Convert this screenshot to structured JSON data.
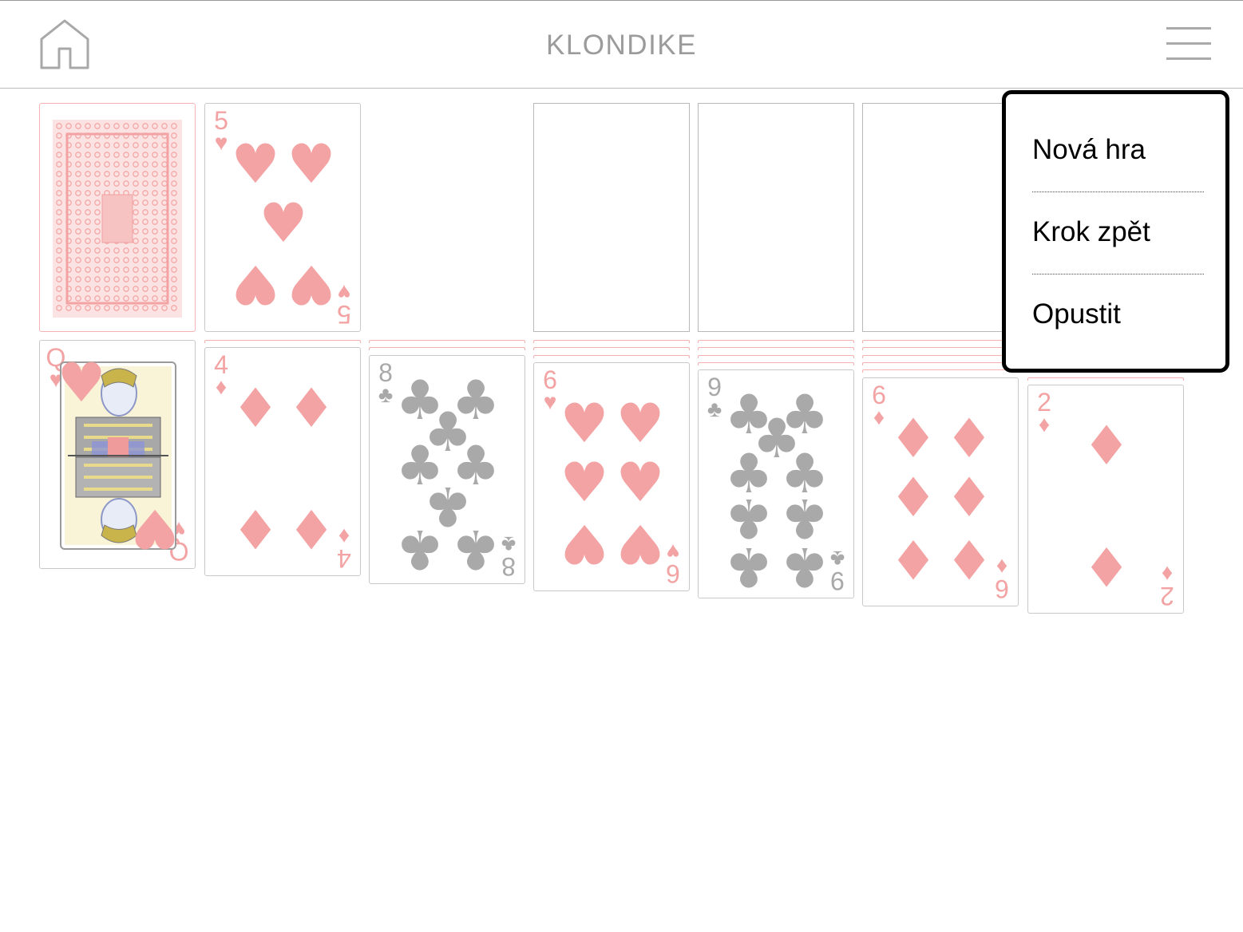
{
  "header": {
    "title": "KLONDIKE",
    "home_icon": "home-icon",
    "menu_icon": "hamburger-menu-icon"
  },
  "colors": {
    "red_suit": "#f3a3a3",
    "black_suit": "#a9a9a9",
    "card_back": "#f6b3b3"
  },
  "stock": {
    "face": "down"
  },
  "waste": {
    "rank": "5",
    "suit": "hearts"
  },
  "foundations": [
    {
      "empty": true
    },
    {
      "empty": true
    },
    {
      "empty": true
    },
    {
      "empty": true
    }
  ],
  "tableau": [
    {
      "hidden": 0,
      "rank": "Q",
      "suit": "hearts"
    },
    {
      "hidden": 1,
      "rank": "4",
      "suit": "diamonds"
    },
    {
      "hidden": 2,
      "rank": "8",
      "suit": "clubs"
    },
    {
      "hidden": 3,
      "rank": "6",
      "suit": "hearts"
    },
    {
      "hidden": 4,
      "rank": "9",
      "suit": "clubs"
    },
    {
      "hidden": 5,
      "rank": "6",
      "suit": "diamonds"
    },
    {
      "hidden": 6,
      "rank": "2",
      "suit": "diamonds"
    }
  ],
  "menu": {
    "items": [
      {
        "label": "Nová hra"
      },
      {
        "label": "Krok zpět"
      },
      {
        "label": "Opustit"
      }
    ]
  }
}
